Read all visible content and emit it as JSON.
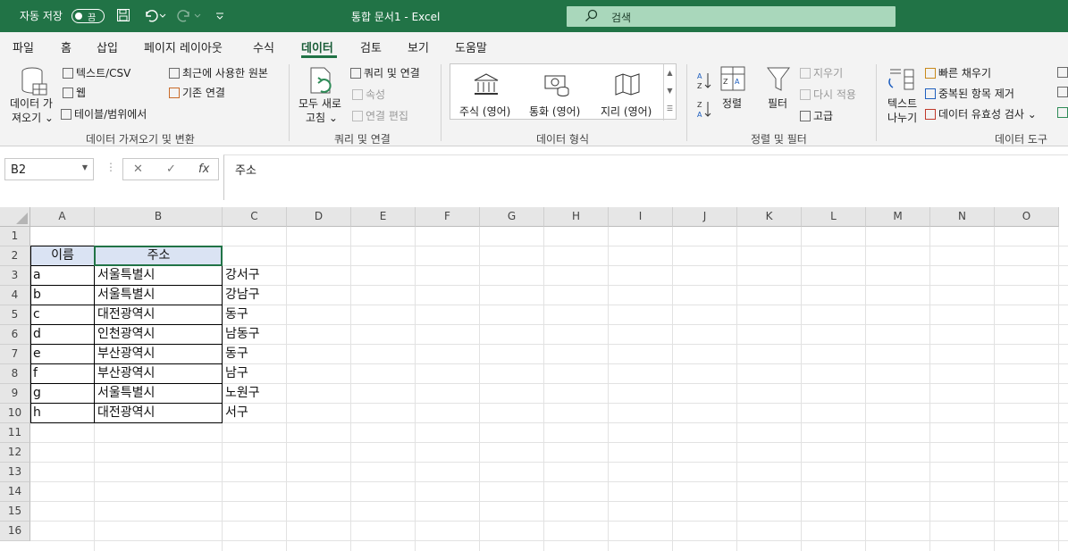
{
  "titlebar": {
    "autosave_label": "자동 저장",
    "autosave_state": "끔",
    "doc_title": "통합 문서1  -  Excel",
    "search_placeholder": "검색"
  },
  "menu": {
    "items": [
      "파일",
      "홈",
      "삽입",
      "페이지 레이아웃",
      "수식",
      "데이터",
      "검토",
      "보기",
      "도움말"
    ],
    "active": "데이터"
  },
  "ribbon": {
    "get_data": {
      "big_label_1": "데이터 가",
      "big_label_2": "져오기 ⌄",
      "text_csv": "텍스트/CSV",
      "web": "웹",
      "table_range": "테이블/범위에서",
      "recent_sources": "최근에 사용한 원본",
      "existing_conn": "기존 연결",
      "group_label": "데이터 가져오기 및 변환"
    },
    "queries": {
      "refresh_1": "모두 새로",
      "refresh_2": "고침 ⌄",
      "queries_conn": "쿼리 및 연결",
      "properties": "속성",
      "edit_links": "연결 편집",
      "group_label": "쿼리 및 연결"
    },
    "data_types": {
      "stocks": "주식 (영어)",
      "currencies": "통화 (영어)",
      "geography": "지리 (영어)",
      "group_label": "데이터 형식"
    },
    "sort_filter": {
      "sort": "정렬",
      "filter": "필터",
      "clear": "지우기",
      "reapply": "다시 적용",
      "advanced": "고급",
      "group_label": "정렬 및 필터"
    },
    "data_tools": {
      "text_to_cols_1": "텍스트",
      "text_to_cols_2": "나누기",
      "flash_fill": "빠른 채우기",
      "remove_dup": "중복된 항목 제거",
      "validation": "데이터 유효성 검사  ⌄",
      "group_label": "데이터 도구"
    }
  },
  "formula_bar": {
    "name_box": "B2",
    "fx": "fx",
    "content": "주소"
  },
  "sheet": {
    "columns": [
      "A",
      "B",
      "C",
      "D",
      "E",
      "F",
      "G",
      "H",
      "I",
      "J",
      "K",
      "L",
      "M",
      "N",
      "O"
    ],
    "rows": [
      "1",
      "2",
      "3",
      "4",
      "5",
      "6",
      "7",
      "8",
      "9",
      "10",
      "11",
      "12",
      "13",
      "14",
      "15",
      "16"
    ],
    "header": {
      "name": "이름",
      "address": "주소"
    },
    "data": [
      {
        "a": "a",
        "b": "서울특별시",
        "c": "강서구"
      },
      {
        "a": "b",
        "b": "서울특별시",
        "c": "강남구"
      },
      {
        "a": "c",
        "b": "대전광역시",
        "c": "동구"
      },
      {
        "a": "d",
        "b": "인천광역시",
        "c": "남동구"
      },
      {
        "a": "e",
        "b": "부산광역시",
        "c": "동구"
      },
      {
        "a": "f",
        "b": "부산광역시",
        "c": "남구"
      },
      {
        "a": "g",
        "b": "서울특별시",
        "c": "노원구"
      },
      {
        "a": "h",
        "b": "대전광역시",
        "c": "서구"
      }
    ]
  }
}
